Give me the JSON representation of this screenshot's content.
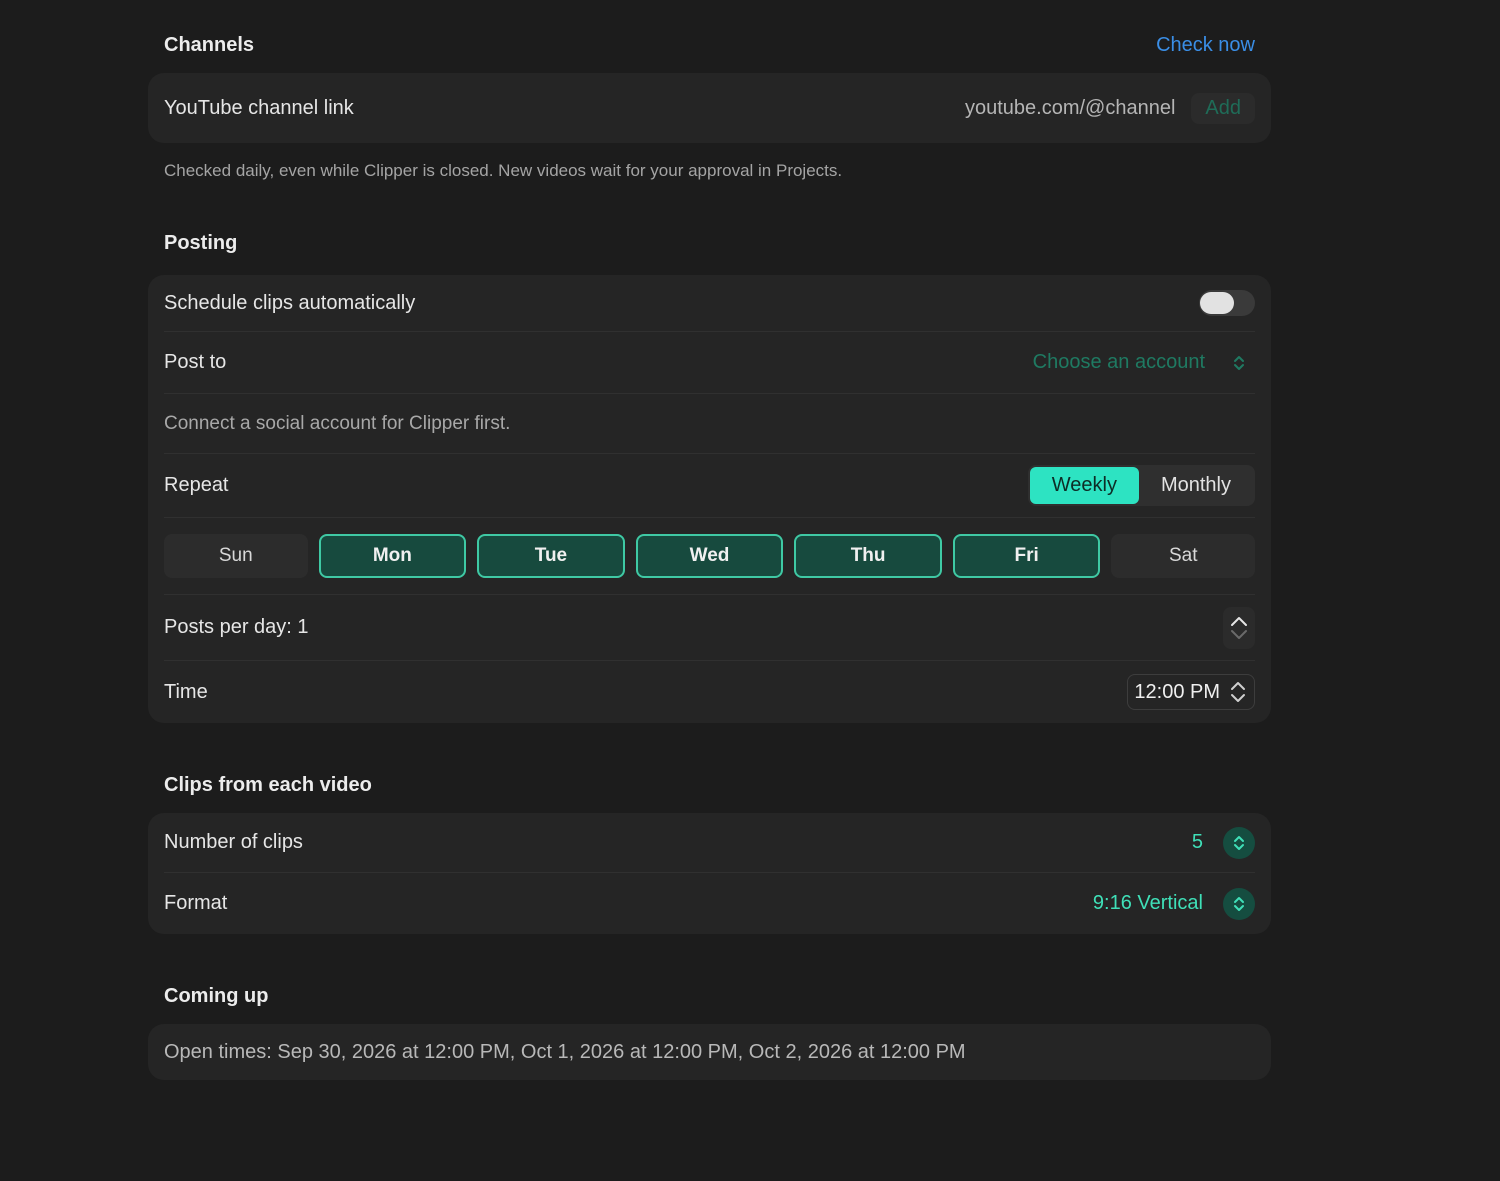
{
  "channels": {
    "title": "Channels",
    "check_now": "Check now",
    "link_label": "YouTube channel link",
    "link_placeholder": "youtube.com/@channel",
    "add_label": "Add",
    "helper": "Checked daily, even while Clipper is closed. New videos wait for your approval in Projects."
  },
  "posting": {
    "title": "Posting",
    "schedule_label": "Schedule clips automatically",
    "schedule_enabled": false,
    "post_to_label": "Post to",
    "post_to_value": "Choose an account",
    "connect_note": "Connect a social account for Clipper first.",
    "repeat_label": "Repeat",
    "repeat_options": [
      "Weekly",
      "Monthly"
    ],
    "repeat_selected": "Weekly",
    "days": [
      {
        "label": "Sun",
        "selected": false
      },
      {
        "label": "Mon",
        "selected": true
      },
      {
        "label": "Tue",
        "selected": true
      },
      {
        "label": "Wed",
        "selected": true
      },
      {
        "label": "Thu",
        "selected": true
      },
      {
        "label": "Fri",
        "selected": true
      },
      {
        "label": "Sat",
        "selected": false
      }
    ],
    "posts_per_day_label": "Posts per day: 1",
    "time_label": "Time",
    "time_value": "12:00 PM"
  },
  "clips": {
    "title": "Clips from each video",
    "number_label": "Number of clips",
    "number_value": "5",
    "format_label": "Format",
    "format_value": "9:16 Vertical"
  },
  "coming_up": {
    "title": "Coming up",
    "text": "Open times: Sep 30, 2026 at 12:00 PM, Oct 1, 2026 at 12:00 PM, Oct 2, 2026 at 12:00 PM"
  },
  "colors": {
    "background": "#1c1c1c",
    "card": "#252525",
    "accent": "#2de3c2",
    "link": "#3a8ee6"
  }
}
